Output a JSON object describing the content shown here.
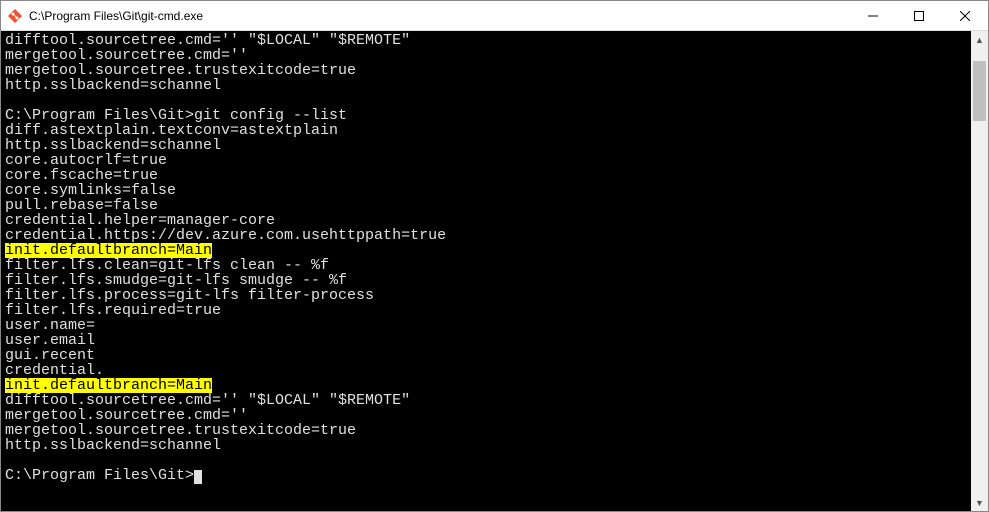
{
  "window": {
    "title": "C:\\Program Files\\Git\\git-cmd.exe"
  },
  "terminal": {
    "lines": [
      {
        "text": "difftool.sourcetree.cmd='' \"$LOCAL\" \"$REMOTE\"",
        "hl": false
      },
      {
        "text": "mergetool.sourcetree.cmd=''",
        "hl": false
      },
      {
        "text": "mergetool.sourcetree.trustexitcode=true",
        "hl": false
      },
      {
        "text": "http.sslbackend=schannel",
        "hl": false
      },
      {
        "text": "",
        "hl": false
      },
      {
        "text": "C:\\Program Files\\Git>git config --list",
        "hl": false
      },
      {
        "text": "diff.astextplain.textconv=astextplain",
        "hl": false
      },
      {
        "text": "http.sslbackend=schannel",
        "hl": false
      },
      {
        "text": "core.autocrlf=true",
        "hl": false
      },
      {
        "text": "core.fscache=true",
        "hl": false
      },
      {
        "text": "core.symlinks=false",
        "hl": false
      },
      {
        "text": "pull.rebase=false",
        "hl": false
      },
      {
        "text": "credential.helper=manager-core",
        "hl": false
      },
      {
        "text": "credential.https://dev.azure.com.usehttppath=true",
        "hl": false
      },
      {
        "text": "init.defaultbranch=Main",
        "hl": true
      },
      {
        "text": "filter.lfs.clean=git-lfs clean -- %f",
        "hl": false
      },
      {
        "text": "filter.lfs.smudge=git-lfs smudge -- %f",
        "hl": false
      },
      {
        "text": "filter.lfs.process=git-lfs filter-process",
        "hl": false
      },
      {
        "text": "filter.lfs.required=true",
        "hl": false
      },
      {
        "text": "user.name=",
        "hl": false
      },
      {
        "text": "user.email",
        "hl": false
      },
      {
        "text": "gui.recent",
        "hl": false
      },
      {
        "text": "credential.",
        "hl": false
      },
      {
        "text": "init.defaultbranch=Main",
        "hl": true
      },
      {
        "text": "difftool.sourcetree.cmd='' \"$LOCAL\" \"$REMOTE\"",
        "hl": false
      },
      {
        "text": "mergetool.sourcetree.cmd=''",
        "hl": false
      },
      {
        "text": "mergetool.sourcetree.trustexitcode=true",
        "hl": false
      },
      {
        "text": "http.sslbackend=schannel",
        "hl": false
      },
      {
        "text": "",
        "hl": false
      }
    ],
    "prompt": "C:\\Program Files\\Git>"
  }
}
